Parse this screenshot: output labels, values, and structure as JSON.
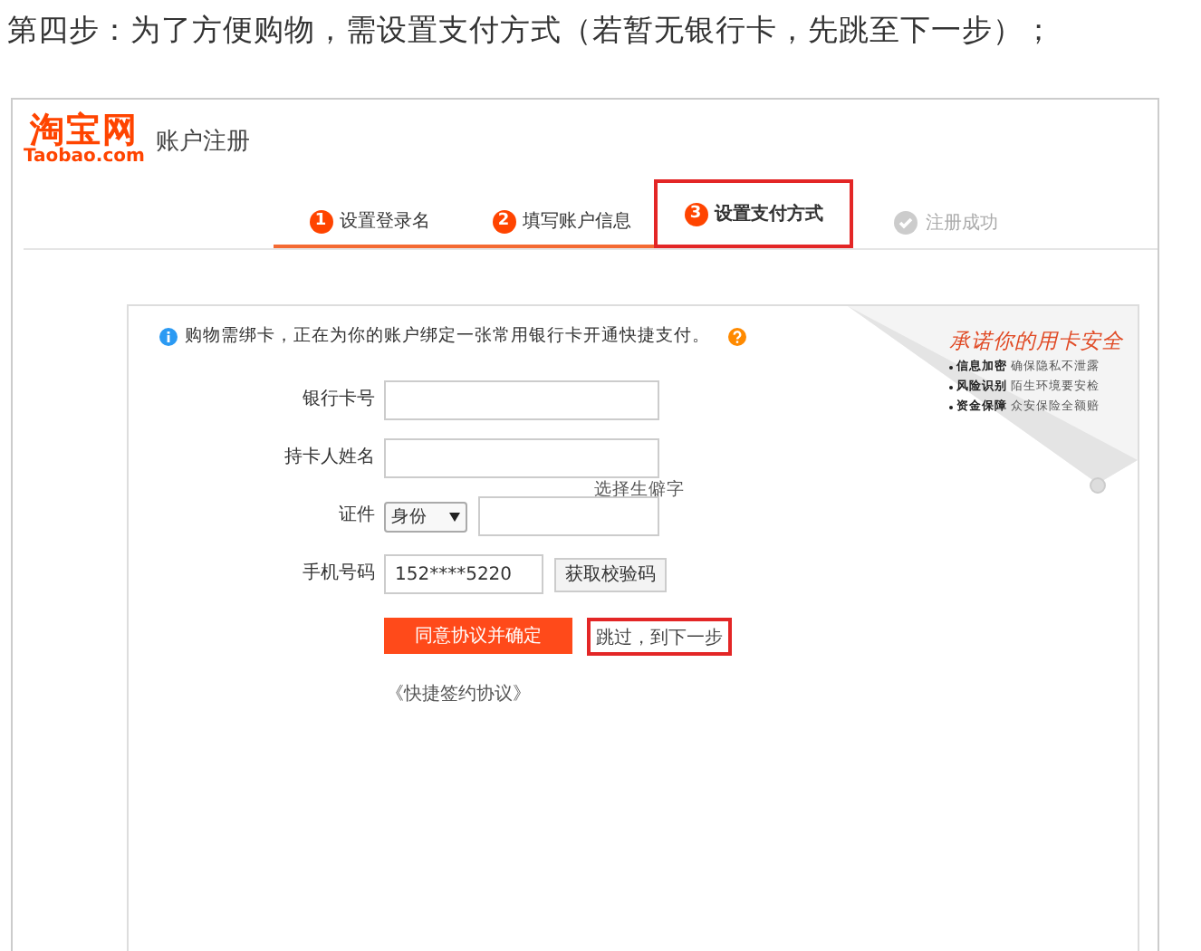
{
  "heading": "第四步：为了方便购物，需设置支付方式（若暂无银行卡，先跳至下一步）；",
  "header": {
    "logo": "淘宝网",
    "logo_domain": "Taobao.com",
    "title": "账户注册"
  },
  "steps": [
    {
      "number": "1",
      "label": "设置登录名",
      "kind": "done",
      "highlighted": false
    },
    {
      "number": "2",
      "label": "填写账户信息",
      "kind": "done",
      "highlighted": false
    },
    {
      "number": "3",
      "label": "设置支付方式",
      "kind": "current",
      "highlighted": true
    },
    {
      "label": "注册成功",
      "kind": "todo",
      "highlighted": false
    }
  ],
  "notice": "购物需绑卡，正在为你的账户绑定一张常用银行卡开通快捷支付。",
  "promo": {
    "title": "承诺你的用卡安全",
    "points": [
      {
        "label": "信息加密",
        "text": "确保隐私不泄露"
      },
      {
        "label": "风险识别",
        "text": "陌生环境要安检"
      },
      {
        "label": "资金保障",
        "text": "众安保险全额赔"
      }
    ]
  },
  "form": [
    {
      "kind": "text",
      "label": "银行卡号"
    },
    {
      "kind": "text",
      "label": "持卡人姓名",
      "hint": "选择生僻字"
    },
    {
      "kind": "id",
      "label": "证件",
      "select": "身份"
    },
    {
      "kind": "phone",
      "label": "手机号码",
      "value": "152****5220",
      "button": "获取校验码"
    }
  ],
  "actions": {
    "submit": "同意协议并确定",
    "skip": {
      "label": "跳过，到下一步",
      "highlighted": true
    }
  },
  "agreement": "《快捷签约协议》"
}
